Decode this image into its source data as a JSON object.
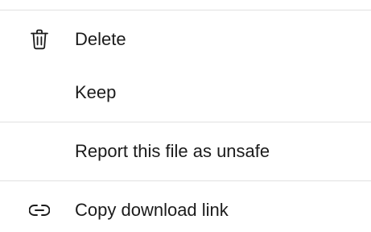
{
  "menu": {
    "items": [
      {
        "label": "Delete",
        "icon": "trash-icon"
      },
      {
        "label": "Keep",
        "icon": null
      },
      {
        "label": "Report this file as unsafe",
        "icon": null
      },
      {
        "label": "Copy download link",
        "icon": "link-icon"
      }
    ]
  },
  "colors": {
    "text": "#1b1b1b",
    "divider": "#e1e1e1",
    "background": "#ffffff"
  }
}
